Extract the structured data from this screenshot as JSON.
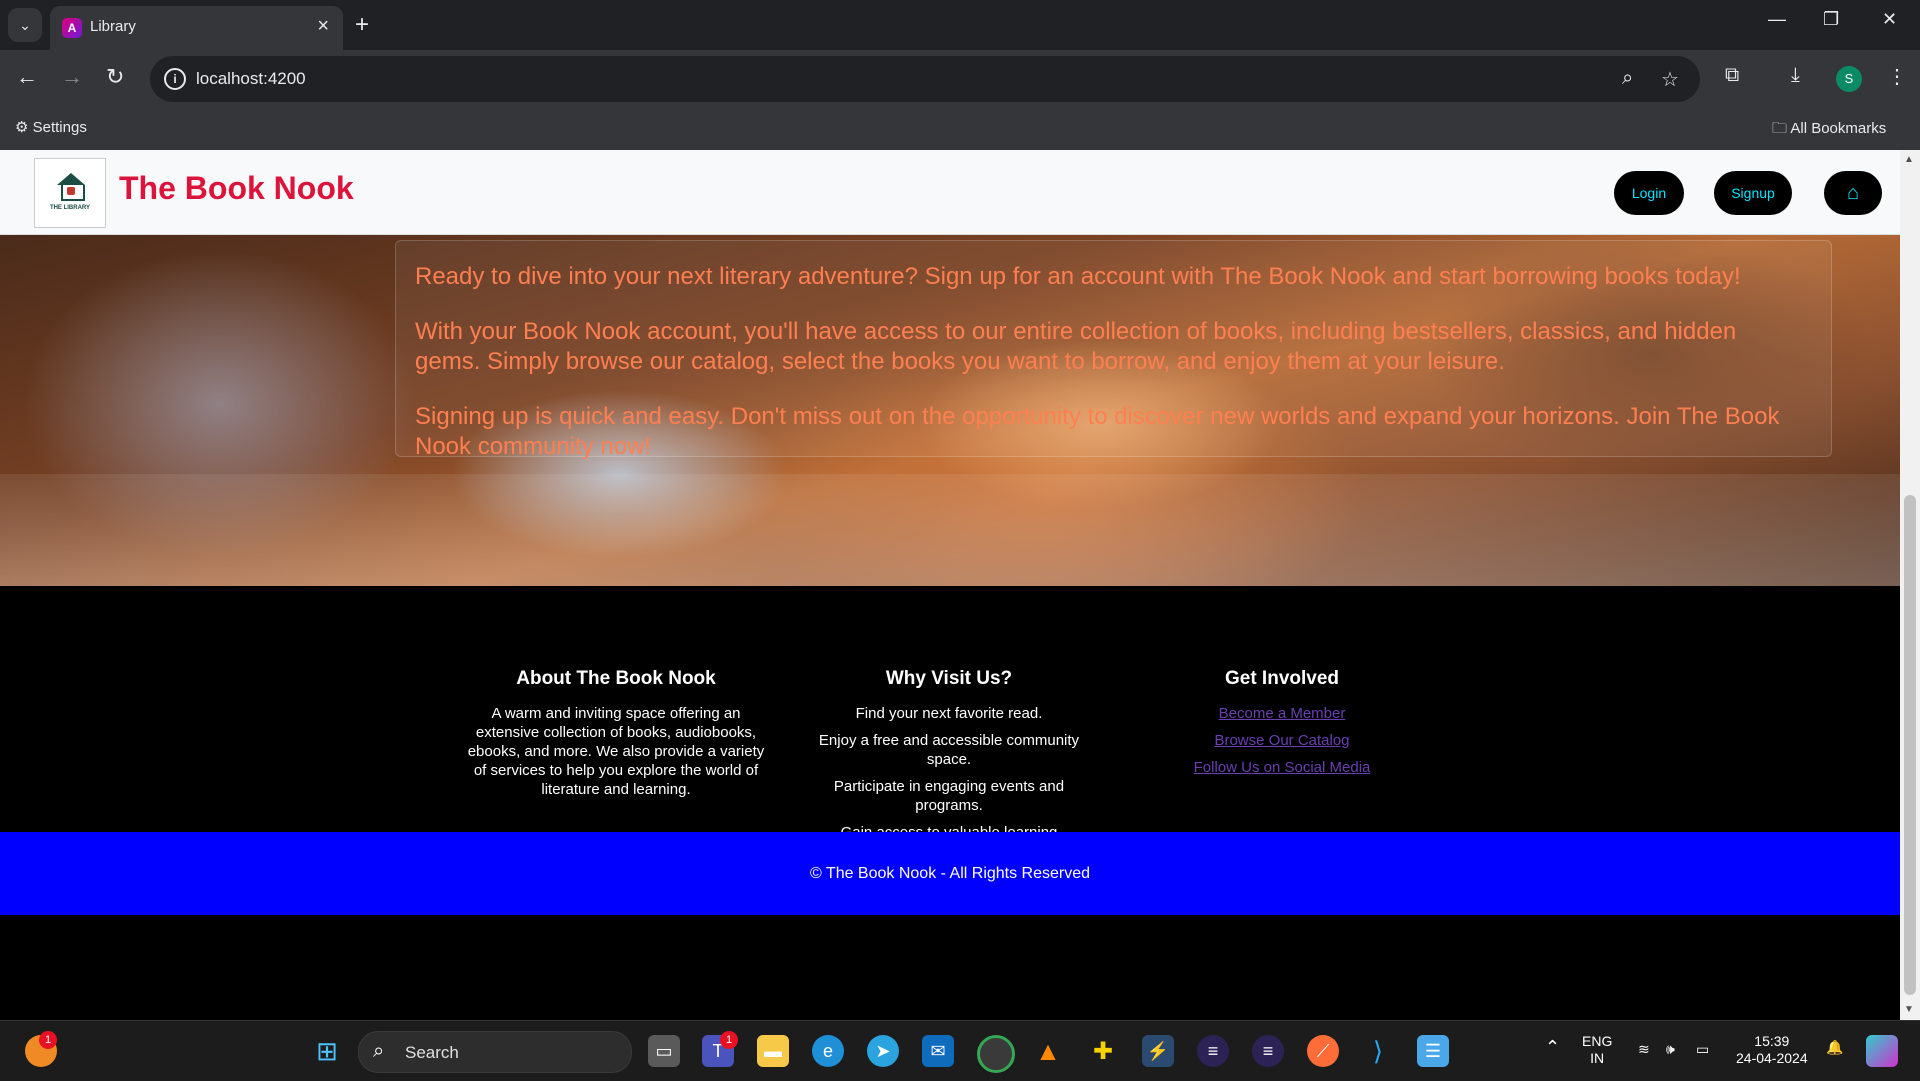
{
  "browser": {
    "tab_title": "Library",
    "url": "localhost:4200",
    "bookmarks": {
      "settings": "Settings",
      "all_bookmarks": "All Bookmarks"
    },
    "profile_initial": "S"
  },
  "header": {
    "brand": "The Book Nook",
    "logo_text": "THE LIBRARY",
    "login": "Login",
    "signup": "Signup"
  },
  "hero": {
    "paragraphs": [
      "Ready to dive into your next literary adventure? Sign up for an account with The Book Nook and start borrowing books today!",
      "With your Book Nook account, you'll have access to our entire collection of books, including bestsellers, classics, and hidden gems. Simply browse our catalog, select the books you want to borrow, and enjoy them at your leisure.",
      "Signing up is quick and easy. Don't miss out on the opportunity to discover new worlds and expand your horizons. Join The Book Nook community now!"
    ],
    "text_color": "#ff7f50"
  },
  "footer": {
    "about": {
      "title": "About The Book Nook",
      "text": "A warm and inviting space offering an extensive collection of books, audiobooks, ebooks, and more. We also provide a variety of services to help you explore the world of literature and learning."
    },
    "why": {
      "title": "Why Visit Us?",
      "items": [
        "Find your next favorite read.",
        "Enjoy a free and accessible community space.",
        "Participate in engaging events and programs.",
        "Gain access to valuable learning resources."
      ]
    },
    "involved": {
      "title": "Get Involved",
      "links": [
        "Become a Member",
        "Browse Our Catalog",
        "Follow Us on Social Media"
      ]
    },
    "copyright": "© The Book Nook - All Rights Reserved",
    "copyright_bg": "#0000ff"
  },
  "taskbar": {
    "search": "Search",
    "lang1": "ENG",
    "lang2": "IN",
    "time": "15:39",
    "date": "24-04-2024",
    "badges": {
      "weather": "1",
      "teams": "1"
    }
  }
}
